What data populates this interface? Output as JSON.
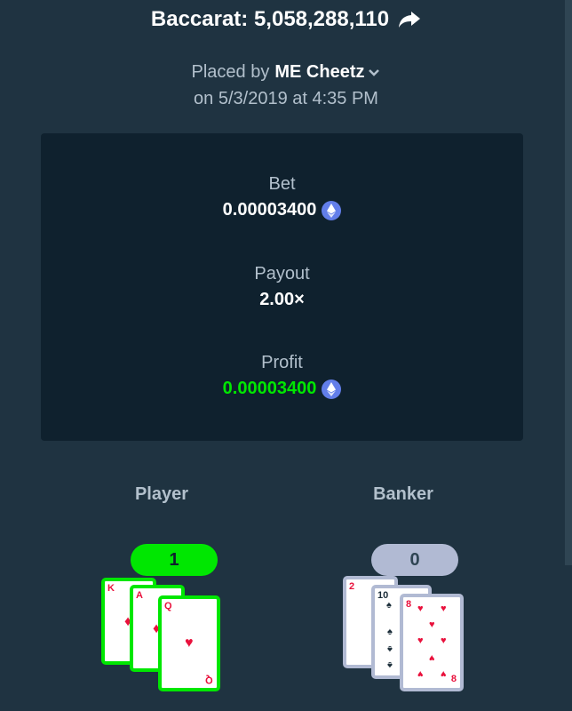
{
  "header": {
    "title": "Baccarat: 5,058,288,110",
    "placed_prefix": "Placed by",
    "username": "ME Cheetz",
    "date_line": "on 5/3/2019 at 4:35 PM"
  },
  "stats": {
    "bet_label": "Bet",
    "bet_value": "0.00003400",
    "payout_label": "Payout",
    "payout_value": "2.00×",
    "profit_label": "Profit",
    "profit_value": "0.00003400",
    "currency_icon": "ethereum-icon"
  },
  "hands": {
    "player": {
      "label": "Player",
      "score": "1",
      "cards": [
        {
          "rank": "K",
          "suit": "diamond"
        },
        {
          "rank": "A",
          "suit": "diamond"
        },
        {
          "rank": "Q",
          "suit": "heart"
        }
      ]
    },
    "banker": {
      "label": "Banker",
      "score": "0",
      "cards": [
        {
          "rank": "2",
          "suit": "heart"
        },
        {
          "rank": "10",
          "suit": "spade"
        },
        {
          "rank": "8",
          "suit": "heart"
        }
      ]
    }
  },
  "colors": {
    "background": "#1f3341",
    "panel": "#0f212e",
    "win": "#00e701",
    "lose": "#b1bad3",
    "suit_red": "#e9113c"
  }
}
